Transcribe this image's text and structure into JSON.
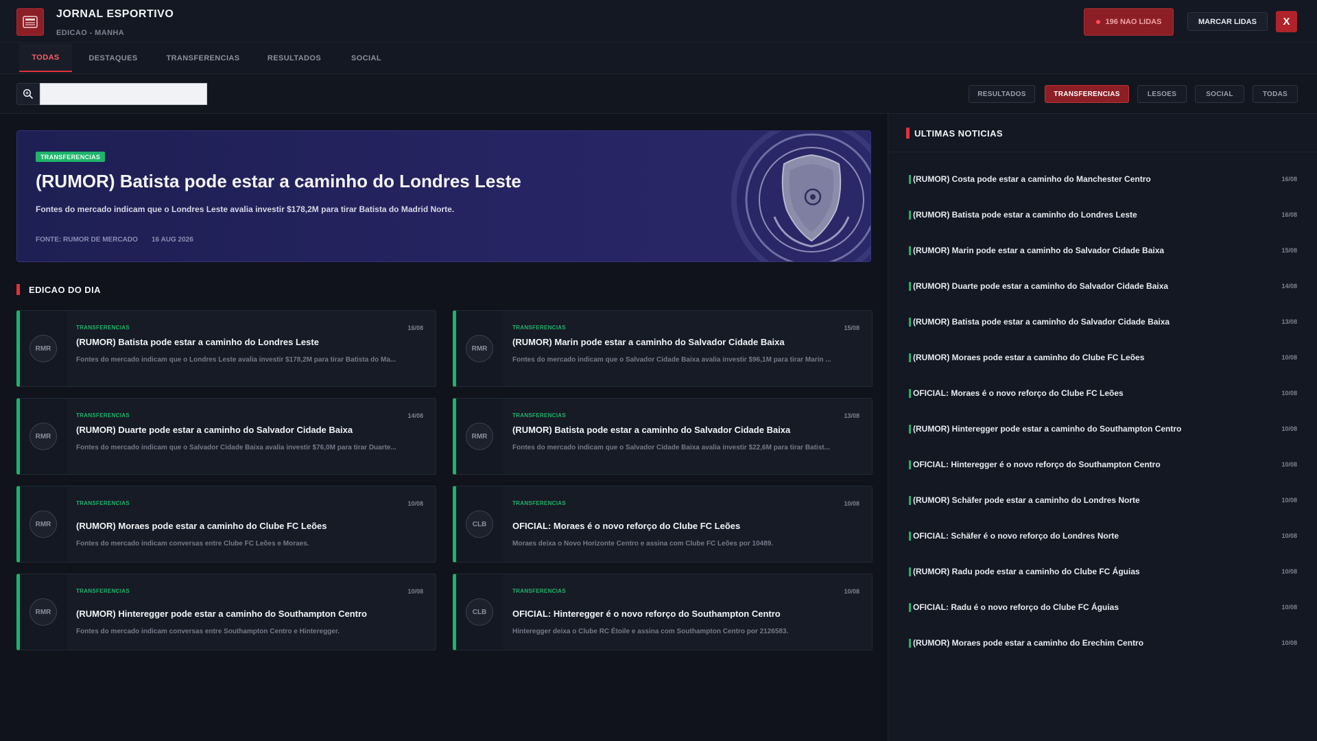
{
  "app": {
    "title": "JORNAL ESPORTIVO",
    "subtitle": "EDICAO - MANHA",
    "unread_label": "196 NAO LIDAS",
    "mark_read_label": "MARCAR LIDAS",
    "close_label": "X"
  },
  "tabs": [
    {
      "label": "TODAS",
      "active": true
    },
    {
      "label": "DESTAQUES",
      "active": false
    },
    {
      "label": "TRANSFERENCIAS",
      "active": false
    },
    {
      "label": "RESULTADOS",
      "active": false
    },
    {
      "label": "SOCIAL",
      "active": false
    }
  ],
  "search": {
    "value": "",
    "placeholder": ""
  },
  "filters": [
    {
      "label": "RESULTADOS",
      "active": false
    },
    {
      "label": "TRANSFERENCIAS",
      "active": true
    },
    {
      "label": "LESOES",
      "active": false
    },
    {
      "label": "SOCIAL",
      "active": false
    },
    {
      "label": "TODAS",
      "active": false
    }
  ],
  "hero": {
    "tag": "TRANSFERENCIAS",
    "title": "(RUMOR) Batista pode estar a caminho do Londres Leste",
    "summary": "Fontes do mercado indicam que o Londres Leste avalia investir $178,2M para tirar Batista do Madrid Norte.",
    "source": "FONTE: RUMOR DE MERCADO",
    "date": "16 AUG 2026"
  },
  "edition": {
    "title": "EDICAO DO DIA",
    "cards": [
      {
        "badge": "RMR",
        "tag": "TRANSFERENCIAS",
        "date": "16/08",
        "title": "(RUMOR) Batista pode estar a caminho do Londres Leste",
        "summary": "Fontes do mercado indicam que o Londres Leste avalia investir $178,2M para tirar Batista do Ma..."
      },
      {
        "badge": "RMR",
        "tag": "TRANSFERENCIAS",
        "date": "15/08",
        "title": "(RUMOR) Marin pode estar a caminho do Salvador Cidade Baixa",
        "summary": "Fontes do mercado indicam que o Salvador Cidade Baixa avalia investir $96,1M para tirar Marin ..."
      },
      {
        "badge": "RMR",
        "tag": "TRANSFERENCIAS",
        "date": "14/08",
        "title": "(RUMOR) Duarte pode estar a caminho do Salvador Cidade Baixa",
        "summary": "Fontes do mercado indicam que o Salvador Cidade Baixa avalia investir $76,0M para tirar Duarte..."
      },
      {
        "badge": "RMR",
        "tag": "TRANSFERENCIAS",
        "date": "13/08",
        "title": "(RUMOR) Batista pode estar a caminho do Salvador Cidade Baixa",
        "summary": "Fontes do mercado indicam que o Salvador Cidade Baixa avalia investir $22,6M para tirar Batist..."
      },
      {
        "badge": "RMR",
        "tag": "TRANSFERENCIAS",
        "date": "10/08",
        "title": "(RUMOR) Moraes pode estar a caminho do Clube FC Leões",
        "summary": "Fontes do mercado indicam conversas entre Clube FC Leões e Moraes."
      },
      {
        "badge": "CLB",
        "tag": "TRANSFERENCIAS",
        "date": "10/08",
        "title": "OFICIAL: Moraes é o novo reforço do Clube FC Leões",
        "summary": "Moraes deixa o Novo Horizonte Centro e assina com Clube FC Leões por 10489."
      },
      {
        "badge": "RMR",
        "tag": "TRANSFERENCIAS",
        "date": "10/08",
        "title": "(RUMOR) Hinteregger pode estar a caminho do Southampton Centro",
        "summary": "Fontes do mercado indicam conversas entre Southampton Centro e Hinteregger."
      },
      {
        "badge": "CLB",
        "tag": "TRANSFERENCIAS",
        "date": "10/08",
        "title": "OFICIAL: Hinteregger é o novo reforço do Southampton Centro",
        "summary": "Hinteregger deixa o Clube RC Étoile e assina com Southampton Centro por 2126583."
      }
    ]
  },
  "latest": {
    "title": "ULTIMAS NOTICIAS",
    "items": [
      {
        "title": "(RUMOR) Costa pode estar a caminho do Manchester Centro",
        "date": "16/08"
      },
      {
        "title": "(RUMOR) Batista pode estar a caminho do Londres Leste",
        "date": "16/08"
      },
      {
        "title": "(RUMOR) Marin pode estar a caminho do Salvador Cidade Baixa",
        "date": "15/08"
      },
      {
        "title": "(RUMOR) Duarte pode estar a caminho do Salvador Cidade Baixa",
        "date": "14/08"
      },
      {
        "title": "(RUMOR) Batista pode estar a caminho do Salvador Cidade Baixa",
        "date": "13/08"
      },
      {
        "title": "(RUMOR) Moraes pode estar a caminho do Clube FC Leões",
        "date": "10/08"
      },
      {
        "title": "OFICIAL: Moraes é o novo reforço do Clube FC Leões",
        "date": "10/08"
      },
      {
        "title": "(RUMOR) Hinteregger pode estar a caminho do Southampton Centro",
        "date": "10/08"
      },
      {
        "title": "OFICIAL: Hinteregger é o novo reforço do Southampton Centro",
        "date": "10/08"
      },
      {
        "title": "(RUMOR) Schäfer pode estar a caminho do Londres Norte",
        "date": "10/08"
      },
      {
        "title": "OFICIAL: Schäfer é o novo reforço do Londres Norte",
        "date": "10/08"
      },
      {
        "title": "(RUMOR) Radu pode estar a caminho do Clube FC Águias",
        "date": "10/08"
      },
      {
        "title": "OFICIAL: Radu é o novo reforço do Clube FC Águias",
        "date": "10/08"
      },
      {
        "title": "(RUMOR) Moraes pode estar a caminho do Erechim Centro",
        "date": "10/08"
      }
    ]
  },
  "colors": {
    "accent_red": "#e0323b",
    "accent_green": "#1fb36b",
    "hero_bg": "#262462"
  }
}
